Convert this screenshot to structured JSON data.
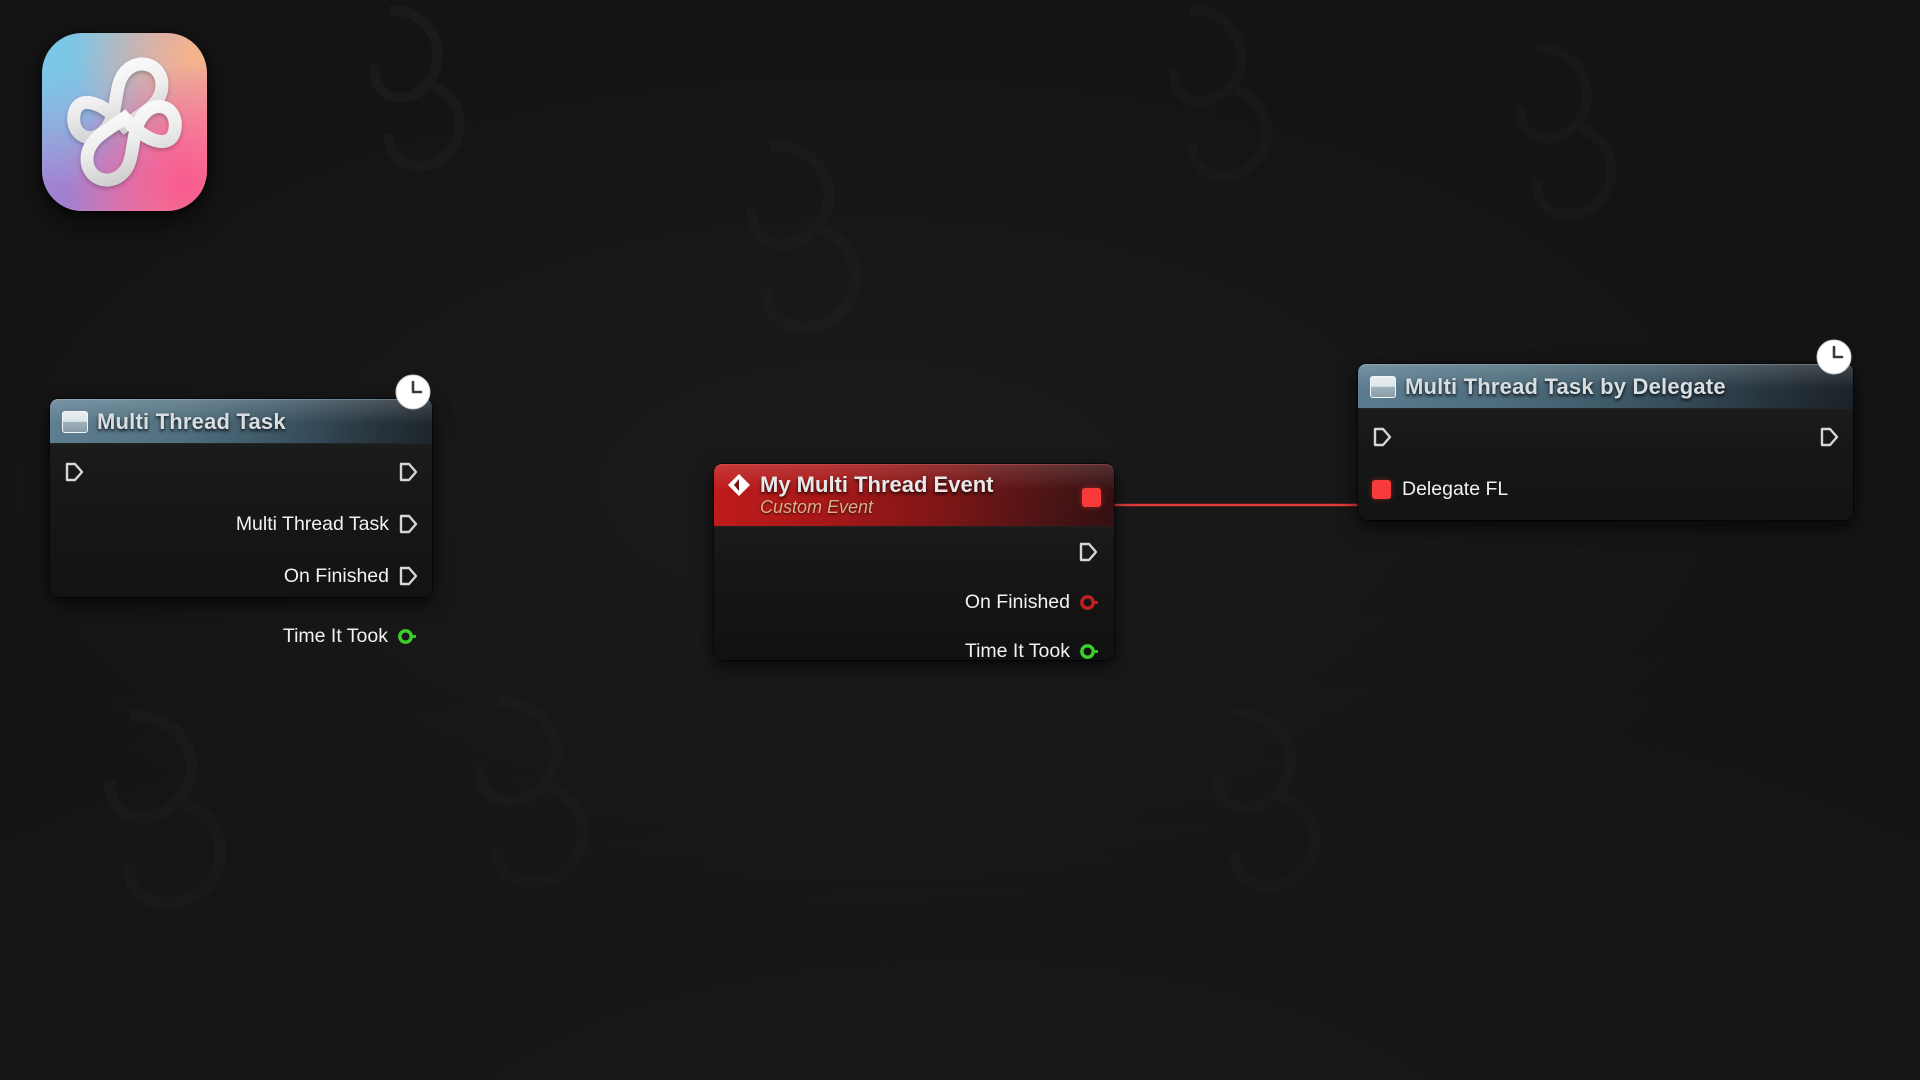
{
  "app": {
    "icon_name": "infinity-knot-app-icon",
    "gradient": {
      "top_left": "#86cbe8",
      "top_right": "#f6a98d",
      "bottom_right": "#f08ab0",
      "bottom_left": "#9f7fd0"
    }
  },
  "canvas": {
    "background_color": "#141414",
    "name": "blueprint-graph-canvas"
  },
  "wire": {
    "color": "#e03030",
    "from": "my-multi-thread-event.delegate-output",
    "to": "multi-thread-task-by-delegate.delegate-fl-input"
  },
  "nodes": [
    {
      "id": "multi-thread-task",
      "title": "Multi Thread Task",
      "type": "function",
      "header_color": "#4d6c7c",
      "badge": "latent-clock-badge",
      "inputs": [
        {
          "label": "",
          "pin": "exec"
        }
      ],
      "outputs": [
        {
          "label": "",
          "pin": "exec"
        },
        {
          "label": "Multi Thread Task",
          "pin": "exec"
        },
        {
          "label": "On Finished",
          "pin": "exec"
        },
        {
          "label": "Time It Took",
          "pin": "data-ring",
          "color": "#3bd12a"
        }
      ]
    },
    {
      "id": "my-multi-thread-event",
      "title": "My Multi Thread Event",
      "subtitle": "Custom Event",
      "type": "event",
      "header_color": "#a81818",
      "outputs": [
        {
          "label": "",
          "pin": "delegate-square",
          "color": "#f93a3a"
        },
        {
          "label": "",
          "pin": "exec"
        },
        {
          "label": "On Finished",
          "pin": "data-ring",
          "color": "#c42020"
        },
        {
          "label": "Time It Took",
          "pin": "data-ring",
          "color": "#3bd12a"
        }
      ]
    },
    {
      "id": "multi-thread-task-by-delegate",
      "title": "Multi Thread Task by Delegate",
      "type": "function",
      "header_color": "#4d6c7c",
      "badge": "latent-clock-badge",
      "inputs": [
        {
          "label": "",
          "pin": "exec"
        },
        {
          "label": "Delegate FL",
          "pin": "delegate-square",
          "color": "#f93a3a"
        }
      ],
      "outputs": [
        {
          "label": "",
          "pin": "exec"
        }
      ]
    }
  ]
}
